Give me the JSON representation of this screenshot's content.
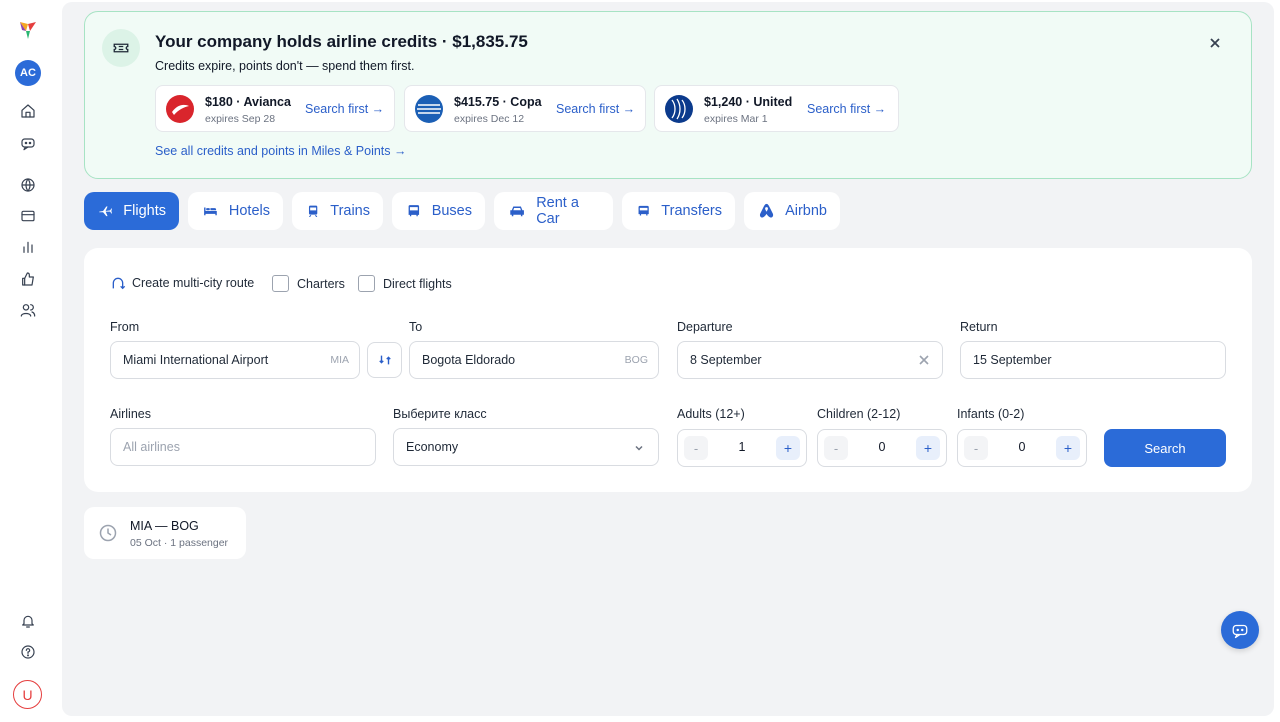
{
  "sidebar": {
    "logo": "brand-logo",
    "account_initials": "AC",
    "user_initial": "U",
    "nav_icons": [
      "home-icon",
      "chat-bot-icon",
      "globe-icon",
      "credit-card-icon",
      "bar-chart-icon",
      "thumbs-up-icon",
      "users-icon"
    ],
    "bottom_icons": [
      "bell-icon",
      "help-icon"
    ]
  },
  "banner": {
    "title": "Your company holds airline credits · $1,835.75",
    "subtitle": "Credits expire, points don't — spend them first.",
    "credits": [
      {
        "amount": "$180 · Avianca",
        "expires": "expires Sep 28",
        "link": "Search first →",
        "color": "#d9252c"
      },
      {
        "amount": "$415.75 · Copa",
        "expires": "expires Dec 12",
        "link": "Search first →",
        "color": "#1b5fb5"
      },
      {
        "amount": "$1,240 · United",
        "expires": "expires Mar 1",
        "link": "Search first →",
        "color": "#0b3a8c"
      }
    ],
    "see_all": "See all credits and points in Miles & Points →"
  },
  "tabs": [
    {
      "label": "Flights",
      "icon": "plane-icon",
      "active": true
    },
    {
      "label": "Hotels",
      "icon": "bed-icon",
      "active": false
    },
    {
      "label": "Trains",
      "icon": "train-icon",
      "active": false
    },
    {
      "label": "Buses",
      "icon": "bus-icon",
      "active": false
    },
    {
      "label": "Rent a Car",
      "icon": "car-icon",
      "active": false
    },
    {
      "label": "Transfers",
      "icon": "transfer-icon",
      "active": false
    },
    {
      "label": "Airbnb",
      "icon": "airbnb-icon",
      "active": false
    }
  ],
  "search": {
    "options": {
      "multi_city": "Create multi-city route",
      "charters": "Charters",
      "direct": "Direct flights"
    },
    "from": {
      "label": "From",
      "value": "Miami International Airport",
      "code": "MIA"
    },
    "to": {
      "label": "To",
      "value": "Bogota Eldorado",
      "code": "BOG"
    },
    "departure": {
      "label": "Departure",
      "value": "8 September"
    },
    "return": {
      "label": "Return",
      "value": "15 September"
    },
    "airlines": {
      "label": "Airlines",
      "placeholder": "All airlines"
    },
    "class": {
      "label": "Выберите класс",
      "value": "Economy"
    },
    "adults": {
      "label": "Adults (12+)",
      "value": "1"
    },
    "children": {
      "label": "Children (2-12)",
      "value": "0"
    },
    "infants": {
      "label": "Infants (0-2)",
      "value": "0"
    },
    "minus": "-",
    "plus": "+",
    "button": "Search"
  },
  "recent": {
    "route": "MIA — BOG",
    "meta": "05 Oct · 1 passenger"
  }
}
